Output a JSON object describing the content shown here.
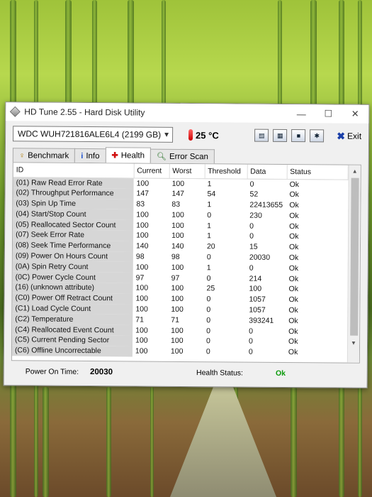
{
  "window": {
    "title": "HD Tune 2.55 - Hard Disk Utility"
  },
  "toolbar": {
    "drive": "WDC    WUH721816ALE6L4 (2199 GB)",
    "temperature": "25 °C",
    "exit_label": "Exit"
  },
  "tabs": [
    {
      "label": "Benchmark",
      "icon": "benchmark-icon"
    },
    {
      "label": "Info",
      "icon": "info-icon"
    },
    {
      "label": "Health",
      "icon": "health-cross-icon",
      "active": true
    },
    {
      "label": "Error Scan",
      "icon": "magnifier-icon"
    }
  ],
  "health": {
    "columns": [
      "ID",
      "Current",
      "Worst",
      "Threshold",
      "Data",
      "Status"
    ],
    "rows": [
      [
        "(01) Raw Read Error Rate",
        "100",
        "100",
        "1",
        "0",
        "Ok"
      ],
      [
        "(02) Throughput Performance",
        "147",
        "147",
        "54",
        "52",
        "Ok"
      ],
      [
        "(03) Spin Up Time",
        "83",
        "83",
        "1",
        "22413655",
        "Ok"
      ],
      [
        "(04) Start/Stop Count",
        "100",
        "100",
        "0",
        "230",
        "Ok"
      ],
      [
        "(05) Reallocated Sector Count",
        "100",
        "100",
        "1",
        "0",
        "Ok"
      ],
      [
        "(07) Seek Error Rate",
        "100",
        "100",
        "1",
        "0",
        "Ok"
      ],
      [
        "(08) Seek Time Performance",
        "140",
        "140",
        "20",
        "15",
        "Ok"
      ],
      [
        "(09) Power On Hours Count",
        "98",
        "98",
        "0",
        "20030",
        "Ok"
      ],
      [
        "(0A) Spin Retry Count",
        "100",
        "100",
        "1",
        "0",
        "Ok"
      ],
      [
        "(0C) Power Cycle Count",
        "97",
        "97",
        "0",
        "214",
        "Ok"
      ],
      [
        "(16) (unknown attribute)",
        "100",
        "100",
        "25",
        "100",
        "Ok"
      ],
      [
        "(C0) Power Off Retract Count",
        "100",
        "100",
        "0",
        "1057",
        "Ok"
      ],
      [
        "(C1) Load Cycle Count",
        "100",
        "100",
        "0",
        "1057",
        "Ok"
      ],
      [
        "(C2) Temperature",
        "71",
        "71",
        "0",
        "393241",
        "Ok"
      ],
      [
        "(C4) Reallocated Event Count",
        "100",
        "100",
        "0",
        "0",
        "Ok"
      ],
      [
        "(C5) Current Pending Sector",
        "100",
        "100",
        "0",
        "0",
        "Ok"
      ],
      [
        "(C6) Offline Uncorrectable",
        "100",
        "100",
        "0",
        "0",
        "Ok"
      ]
    ]
  },
  "status": {
    "power_on_label": "Power On Time:",
    "power_on_value": "20030",
    "health_label": "Health Status:",
    "health_value": "Ok"
  },
  "colors": {
    "ok_green": "#0a9a0a",
    "id_column_bg": "#d6d6d6"
  }
}
